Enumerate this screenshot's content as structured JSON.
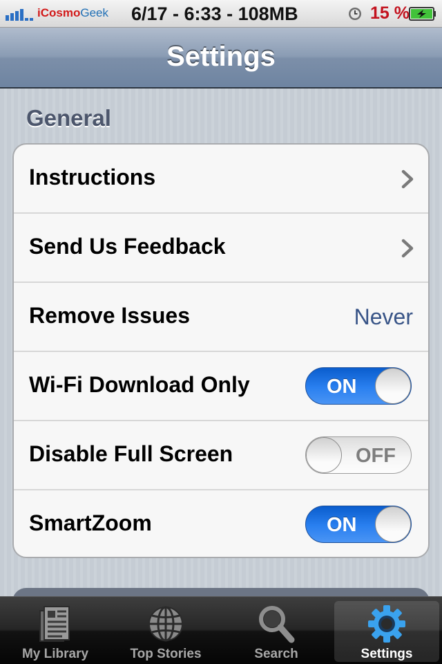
{
  "status_bar": {
    "carrier_prefix": "iCosmo",
    "carrier_suffix": "Geek",
    "center_text": "6/17 - 6:33 - 108MB",
    "battery_percent": "15 %",
    "battery_level": 0.15,
    "icons": [
      "signal-bars-icon",
      "alarm-clock-icon",
      "battery-charging-icon"
    ]
  },
  "nav": {
    "title": "Settings"
  },
  "section": {
    "header": "General"
  },
  "rows": [
    {
      "label": "Instructions",
      "accessory": "chevron"
    },
    {
      "label": "Send Us Feedback",
      "accessory": "chevron"
    },
    {
      "label": "Remove Issues",
      "value": "Never"
    },
    {
      "label": "Wi-Fi Download Only",
      "toggle": "ON"
    },
    {
      "label": "Disable Full Screen",
      "toggle": "OFF"
    },
    {
      "label": "SmartZoom",
      "toggle": "ON"
    }
  ],
  "tabs": [
    {
      "label": "My Library",
      "icon": "newspaper-icon",
      "selected": false
    },
    {
      "label": "Top Stories",
      "icon": "globe-icon",
      "selected": false
    },
    {
      "label": "Search",
      "icon": "magnifier-icon",
      "selected": false
    },
    {
      "label": "Settings",
      "icon": "gear-icon",
      "selected": true
    }
  ],
  "colors": {
    "accent": "#2a80f0",
    "value_text": "#385487",
    "battery_text": "#c3121e"
  }
}
